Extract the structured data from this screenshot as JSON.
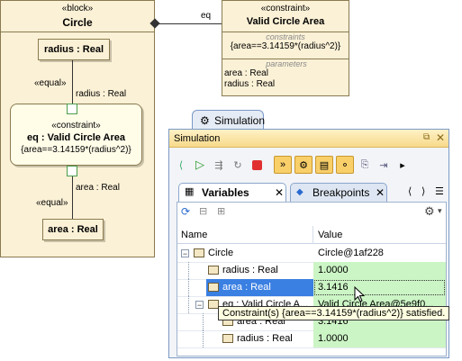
{
  "diagram": {
    "block": {
      "stereotype": "«block»",
      "name": "Circle"
    },
    "radius_part": {
      "label": "radius : Real"
    },
    "area_part": {
      "label": "area : Real"
    },
    "equal_top": "«equal»",
    "equal_bottom": "«equal»",
    "radius_conn_label": "radius : Real",
    "area_conn_label": "area : Real",
    "eq_property": {
      "stereotype": "«constraint»",
      "name": "eq : Valid Circle Area",
      "expression": "{area==3.14159*(radius^2)}"
    },
    "eq_association_label": "eq",
    "constraint_block": {
      "stereotype": "«constraint»",
      "name": "Valid Circle Area",
      "constraints_header": "constraints",
      "expression": "{area==3.14159*(radius^2)}",
      "parameters_header": "parameters",
      "parameters": [
        "area : Real",
        "radius : Real"
      ]
    }
  },
  "simulation": {
    "outer_tab_label": "Simulation",
    "window_title": "Simulation",
    "tabs": [
      {
        "label": "Variables",
        "active": true
      },
      {
        "label": "Breakpoints",
        "active": false
      }
    ],
    "table": {
      "columns": [
        "Name",
        "Value"
      ],
      "rows": [
        {
          "name": "Circle",
          "value": "Circle@1af228",
          "level": 0,
          "expander": "−",
          "selected": false,
          "value_green": false
        },
        {
          "name": "radius : Real",
          "value": "1.0000",
          "level": 1,
          "expander": "",
          "selected": false,
          "value_green": true
        },
        {
          "name": "area : Real",
          "value": "3.1416",
          "level": 1,
          "expander": "",
          "selected": true,
          "value_green": true
        },
        {
          "name": "eq : Valid Circle A...",
          "value": "Valid Circle Area@5e9f0...",
          "level": 1,
          "expander": "−",
          "selected": false,
          "value_green": true
        },
        {
          "name": "area : Real",
          "value": "3.1416",
          "level": 2,
          "expander": "",
          "selected": false,
          "value_green": true
        },
        {
          "name": "radius : Real",
          "value": "1.0000",
          "level": 2,
          "expander": "",
          "selected": false,
          "value_green": true
        }
      ]
    },
    "tooltip": "Constraint(s) {area==3.14159*(radius^2)} satisfied.",
    "colors": {
      "window_border": "#7a99c6",
      "selection": "#3a7fe2",
      "satisfied_green": "#ccf5c5",
      "title_gradient": "#f7d98a"
    }
  }
}
